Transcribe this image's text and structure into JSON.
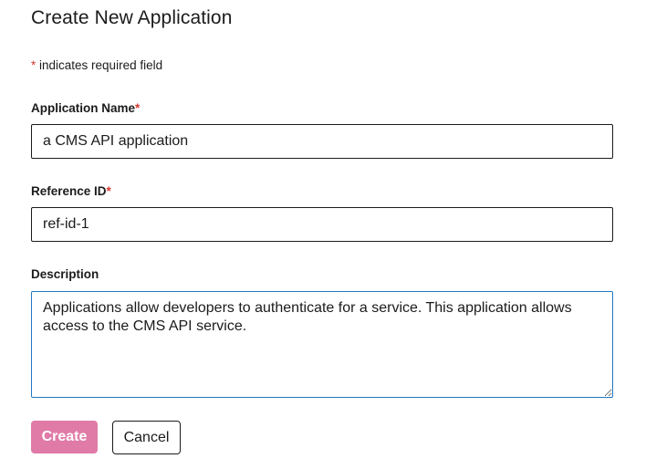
{
  "page": {
    "title": "Create New Application"
  },
  "required_note": {
    "asterisk": "*",
    "text": " indicates required field"
  },
  "fields": {
    "application_name": {
      "label": "Application Name",
      "required_marker": "*",
      "value": "a CMS API application"
    },
    "reference_id": {
      "label": "Reference ID",
      "required_marker": "*",
      "value": "ref-id-1"
    },
    "description": {
      "label": "Description",
      "value": "Applications allow developers to authenticate for a service. This application allows access to the CMS API service."
    }
  },
  "actions": {
    "create_label": "Create",
    "cancel_label": "Cancel"
  },
  "colors": {
    "required_asterisk": "#d83933",
    "create_button_bg": "#e07ba8",
    "focused_border": "#2378c3"
  }
}
